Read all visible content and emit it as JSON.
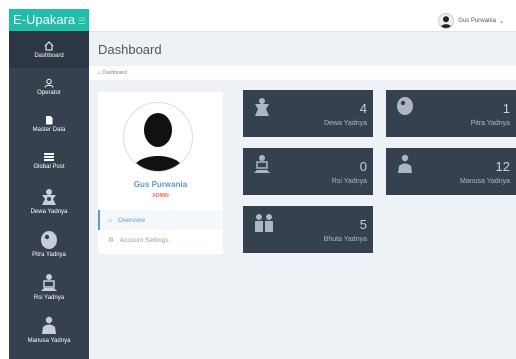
{
  "brand": {
    "title": "E-Upakara"
  },
  "sidebar": {
    "items": [
      {
        "label": "Dashboard",
        "icon": "home-icon"
      },
      {
        "label": "Operator",
        "icon": "user-icon"
      },
      {
        "label": "Master Data",
        "icon": "document-icon"
      },
      {
        "label": "Global Post",
        "icon": "list-icon"
      },
      {
        "label": "Dewa Yadnya",
        "icon": "deity-icon"
      },
      {
        "label": "Pitra Yadnya",
        "icon": "ancestor-icon"
      },
      {
        "label": "Rsi Yadnya",
        "icon": "sage-icon"
      },
      {
        "label": "Manusa Yadnya",
        "icon": "person-icon"
      }
    ]
  },
  "topbar": {
    "user_name": "Gus Purwania"
  },
  "page": {
    "title": "Dashboard",
    "breadcrumb": "Dashboard"
  },
  "profile": {
    "name": "Gus Purwania",
    "role": "ADMIN",
    "menu": [
      {
        "label": "Overview"
      },
      {
        "label": "Account Settings"
      }
    ]
  },
  "stats": [
    {
      "value": "4",
      "label": "Dewa Yadnya"
    },
    {
      "value": "1",
      "label": "Pitra Yadnya"
    },
    {
      "value": "0",
      "label": "Rsi Yadnya"
    },
    {
      "value": "12",
      "label": "Manusa Yadnya"
    },
    {
      "value": "5",
      "label": "Bhuta Yadnya"
    }
  ],
  "colors": {
    "brand": "#20bda9",
    "sidebar": "#364150",
    "accent": "#5b9bd1",
    "role": "#f36a5a"
  }
}
